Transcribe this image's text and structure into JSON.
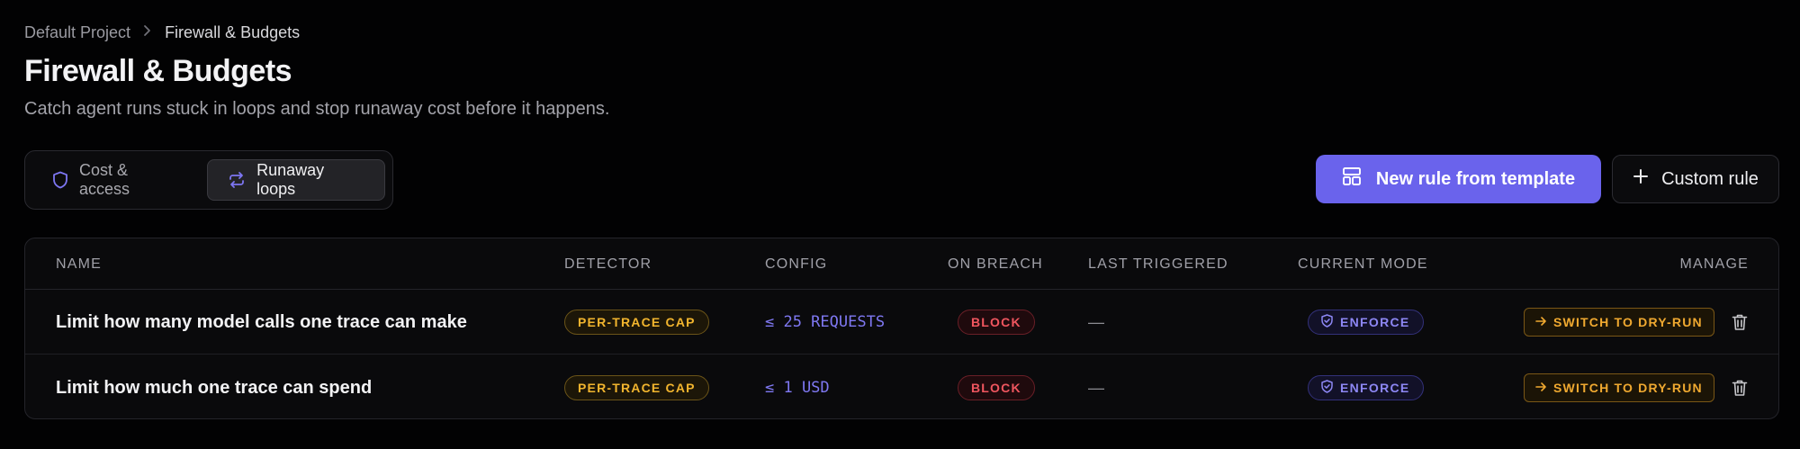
{
  "breadcrumb": {
    "root": "Default Project",
    "current": "Firewall & Budgets"
  },
  "page": {
    "title": "Firewall & Budgets",
    "subtitle": "Catch agent runs stuck in loops and stop runaway cost before it happens."
  },
  "tabs": [
    {
      "label": "Cost & access",
      "icon": "shield-icon",
      "active": false
    },
    {
      "label": "Runaway loops",
      "icon": "repeat-icon",
      "active": true
    }
  ],
  "actions": {
    "new_from_template": "New rule from template",
    "custom_rule": "Custom rule"
  },
  "table": {
    "columns": [
      "NAME",
      "DETECTOR",
      "CONFIG",
      "ON BREACH",
      "LAST TRIGGERED",
      "CURRENT MODE",
      "MANAGE"
    ],
    "rows": [
      {
        "name": "Limit how many model calls one trace can make",
        "detector": "PER-TRACE CAP",
        "config": "≤ 25 REQUESTS",
        "on_breach": "BLOCK",
        "last_triggered": "—",
        "mode": "ENFORCE",
        "manage": "SWITCH TO DRY-RUN"
      },
      {
        "name": "Limit how much one trace can spend",
        "detector": "PER-TRACE CAP",
        "config": "≤ 1 USD",
        "on_breach": "BLOCK",
        "last_triggered": "—",
        "mode": "ENFORCE",
        "manage": "SWITCH TO DRY-RUN"
      }
    ]
  },
  "colors": {
    "accent": "#6a63ec",
    "detector": "#f2b52e",
    "block": "#f0565f",
    "enforce": "#8d87f4",
    "dry_run": "#f0a930"
  }
}
